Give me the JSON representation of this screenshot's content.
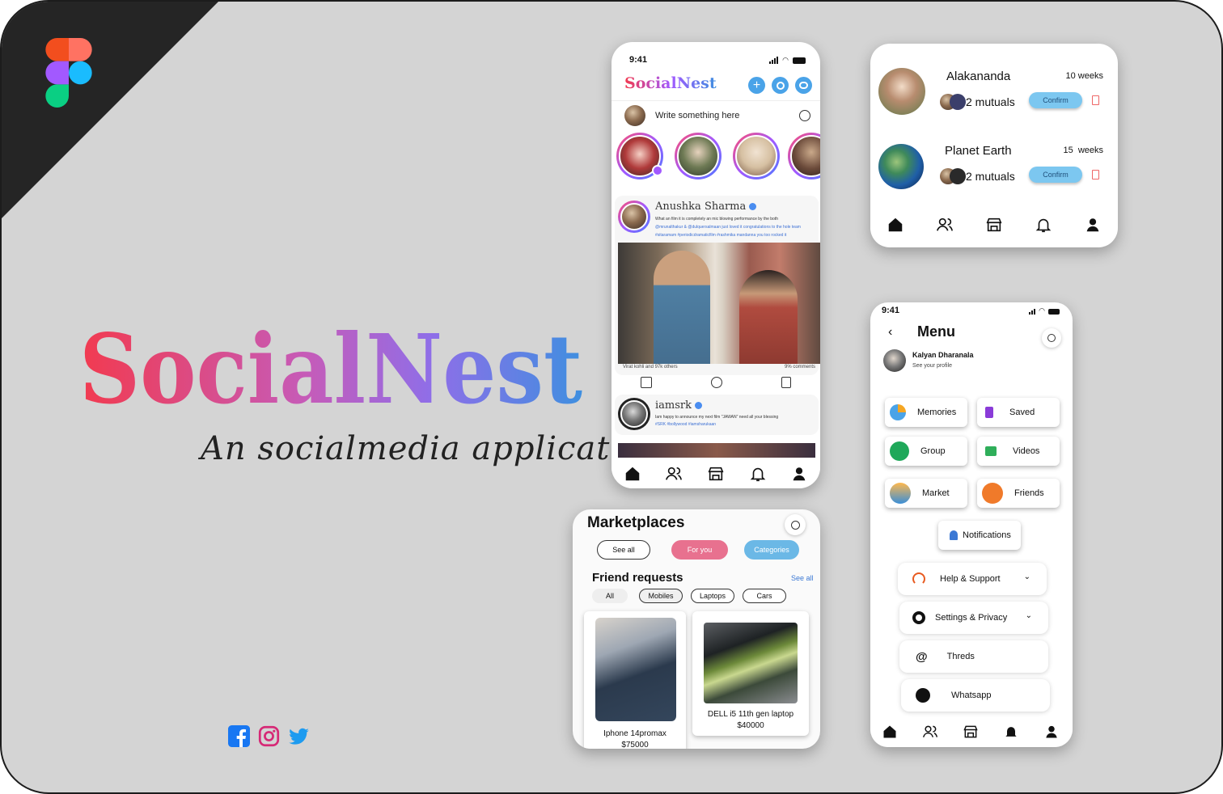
{
  "brand": {
    "name": "SocialNest",
    "tagline": "An socialmedia application"
  },
  "feed": {
    "time": "9:41",
    "app_title": "SocialNest",
    "composer_placeholder": "Write something here",
    "post1": {
      "author": "Anushka Sharma",
      "text1": "What an film it is completely an mic blowing performance by the both",
      "text2": "@mrunalthakur & @dulquersalmaan just loved it congratulations to the hole team",
      "text3": "#sitaramam #periodicdramaticfilm #rashmika mandanna you too rocked it",
      "reactions": "Virat kohli and 97k others",
      "comments": "9% comments"
    },
    "post2": {
      "author": "iamsrk",
      "text1": "Iam happy to announce my next film \"JAWAN\" need all your blessing",
      "text2": "#SRK #bollywood #iamsharukaan"
    }
  },
  "requests": {
    "items": [
      {
        "name": "Alakananda",
        "age": "10 weeks",
        "mutuals": "2 mutuals",
        "confirm": "Confirm"
      },
      {
        "name": "Planet Earth",
        "age": "15  weeks",
        "mutuals": "2 mutuals",
        "confirm": "Confirm"
      }
    ]
  },
  "market": {
    "title": "Marketplaces",
    "tabs": [
      "See all",
      "For you",
      "Categories"
    ],
    "section": "Friend requests",
    "see_all": "See all",
    "filters": [
      "All",
      "Mobiles",
      "Laptops",
      "Cars"
    ],
    "products": [
      {
        "name": "Iphone 14promax",
        "price": "$75000"
      },
      {
        "name": "DELL i5 11th gen laptop",
        "price": "$40000"
      }
    ]
  },
  "menu": {
    "time": "9:41",
    "title": "Menu",
    "profile_name": "Kalyan Dharanala",
    "profile_sub": "See your profile",
    "tiles": [
      "Memories",
      "Saved",
      "Group",
      "Videos",
      "Market",
      "Friends",
      "Notifications"
    ],
    "rows": [
      "Help & Support",
      "Settings & Privacy",
      "Threds",
      "Whatsapp"
    ]
  },
  "colors": {
    "canvas": "#d4d4d4",
    "accent_blue": "#4aa3e8",
    "pink": "#e8718f",
    "confirm": "#7cc7f0"
  }
}
